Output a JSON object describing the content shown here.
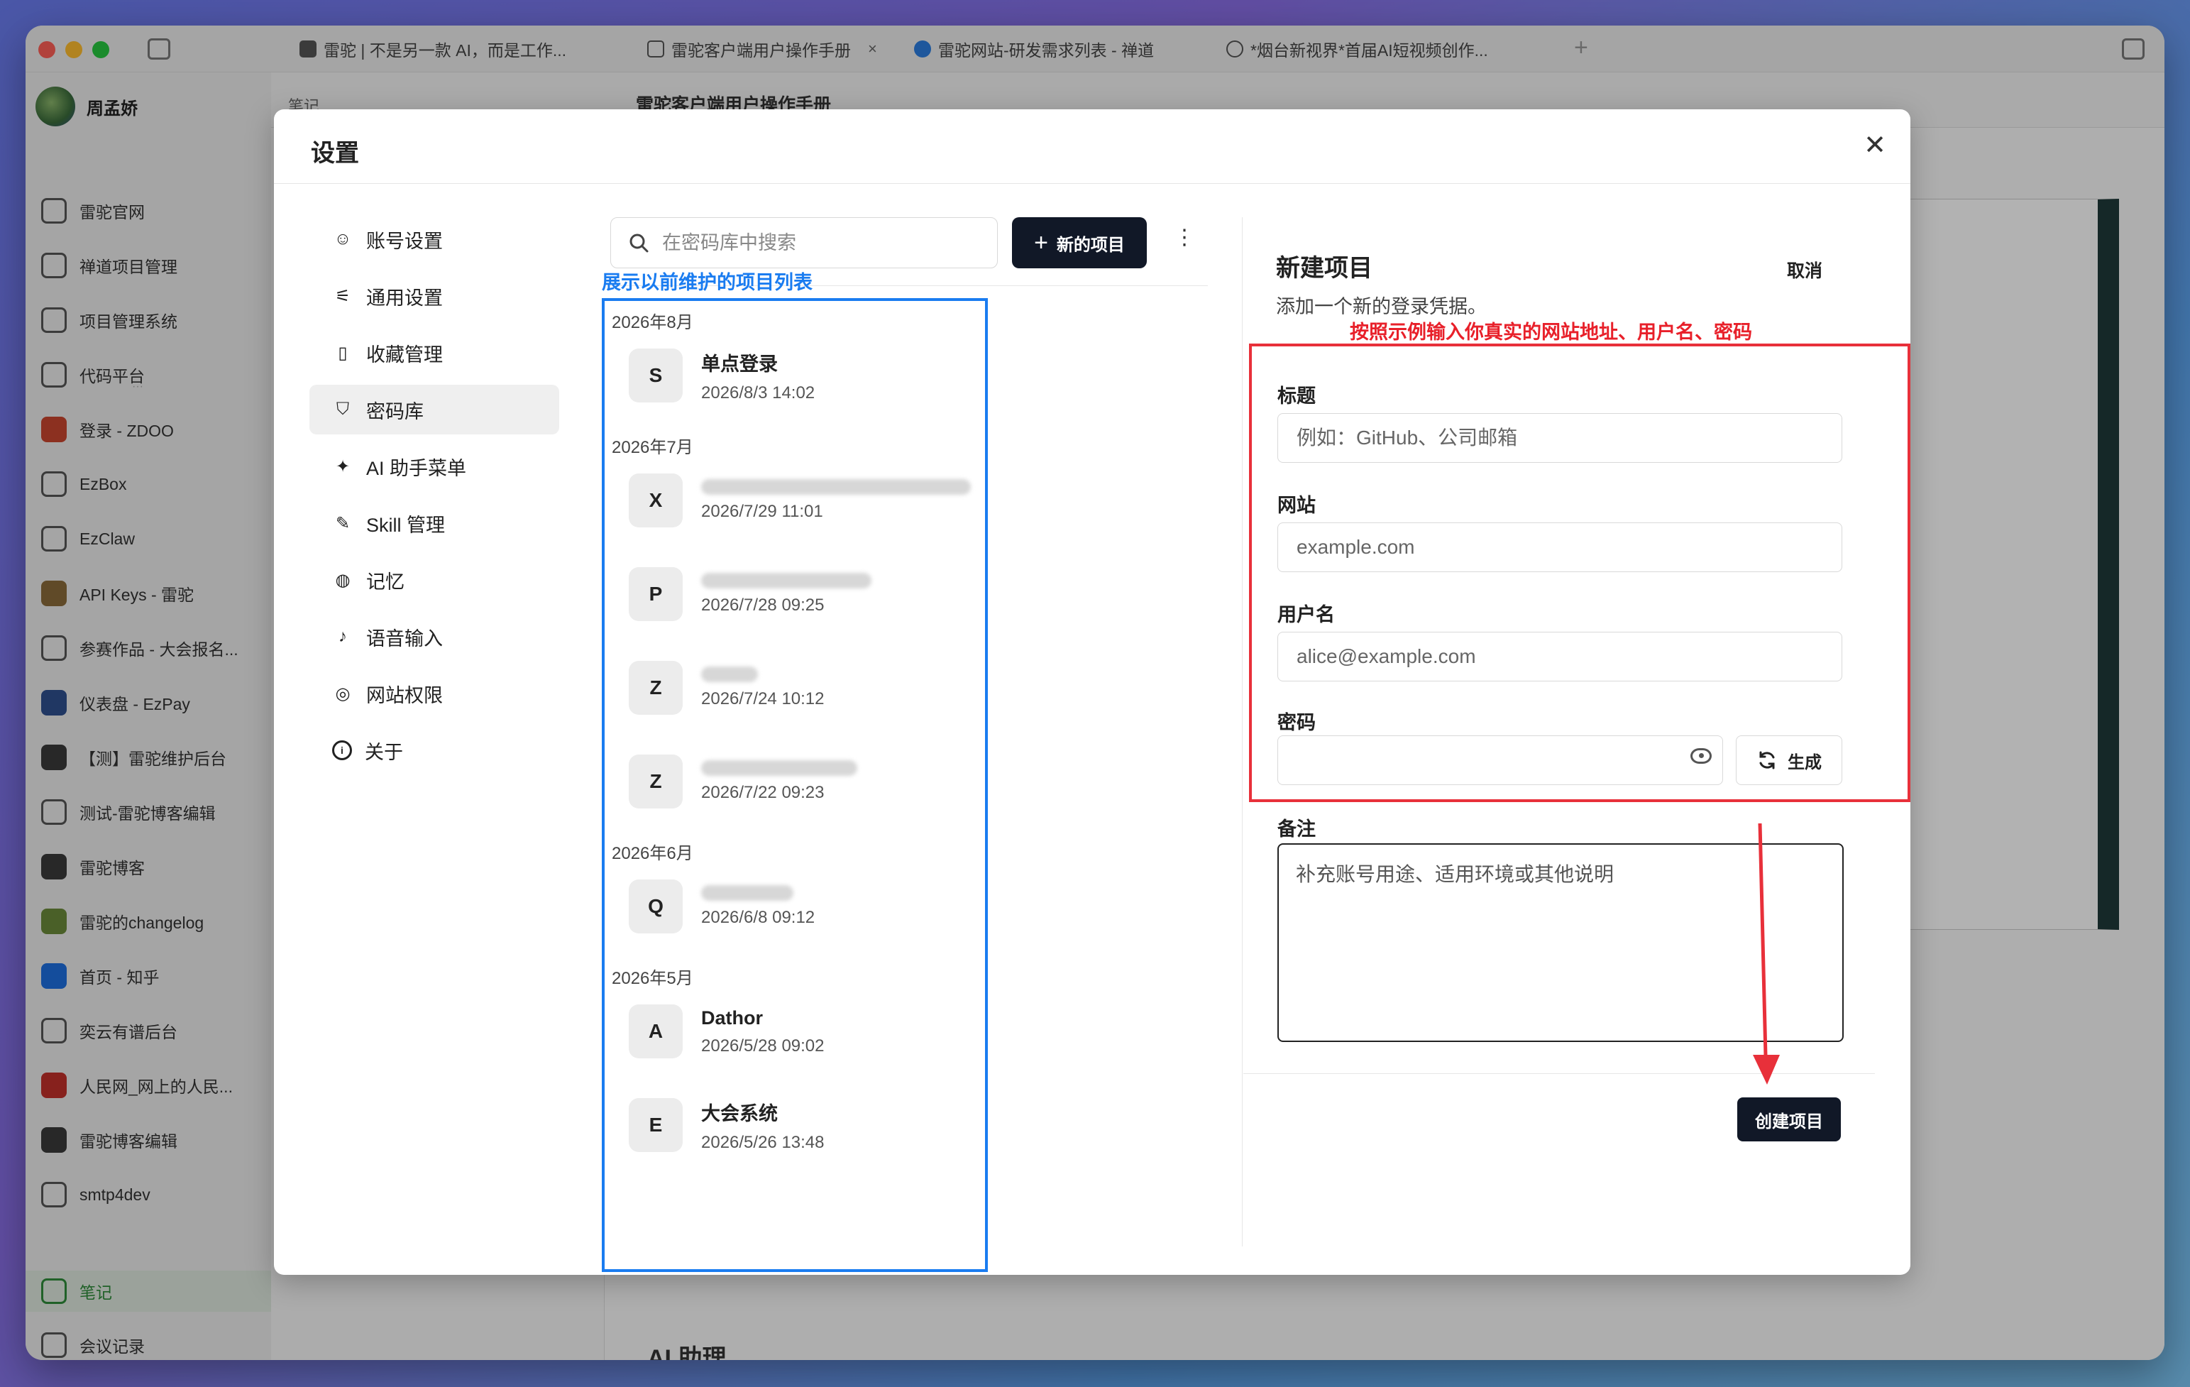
{
  "tabs": [
    {
      "label": "雷驼 | 不是另一款 AI，而是工作..."
    },
    {
      "label": "雷驼客户端用户操作手册"
    },
    {
      "label": "雷驼网站-研发需求列表 - 禅道"
    },
    {
      "label": "*烟台新视界*首届AI短视频创作..."
    }
  ],
  "app_sidebar": {
    "user": "周孟娇",
    "items": [
      {
        "label": "雷驼官网",
        "icon": "home-icon"
      },
      {
        "label": "禅道项目管理",
        "icon": "briefcase-icon"
      },
      {
        "label": "项目管理系统",
        "icon": "grid-icon"
      },
      {
        "label": "代码平台",
        "icon": "code-icon"
      },
      {
        "label": "登录 - ZDOO",
        "icon": "zdoo-icon"
      },
      {
        "label": "EzBox",
        "icon": "folder-icon"
      },
      {
        "label": "EzClaw",
        "icon": "mail-icon"
      },
      {
        "label": "API Keys - 雷驼",
        "icon": "camel-icon"
      },
      {
        "label": "参赛作品 - 大会报名...",
        "icon": "globe-icon"
      },
      {
        "label": "仪表盘 - EzPay",
        "icon": "ezpay-icon"
      },
      {
        "label": "【测】雷驼维护后台",
        "icon": "admin-icon"
      },
      {
        "label": "测试-雷驼博客编辑",
        "icon": "globe-icon"
      },
      {
        "label": "雷驼博客",
        "icon": "blog-icon"
      },
      {
        "label": "雷驼的changelog",
        "icon": "camel-icon"
      },
      {
        "label": "首页 - 知乎",
        "icon": "zhihu-icon"
      },
      {
        "label": "奕云有谱后台",
        "icon": "globe-icon"
      },
      {
        "label": "人民网_网上的人民...",
        "icon": "people-icon"
      },
      {
        "label": "雷驼博客编辑",
        "icon": "blog-icon"
      },
      {
        "label": "smtp4dev",
        "icon": "globe-icon"
      }
    ],
    "bottom": [
      {
        "label": "笔记",
        "icon": "note-icon"
      },
      {
        "label": "会议记录",
        "icon": "calendar-icon"
      }
    ]
  },
  "behind": {
    "notes_label": "笔记",
    "doc_title": "雷驼客户端用户操作手册",
    "ai_title": "AI 助理"
  },
  "dialog": {
    "title": "设置",
    "nav": [
      {
        "label": "账号设置",
        "icon": "user-circle-icon"
      },
      {
        "label": "通用设置",
        "icon": "sliders-icon"
      },
      {
        "label": "收藏管理",
        "icon": "bookmark-icon"
      },
      {
        "label": "密码库",
        "icon": "shield-icon"
      },
      {
        "label": "AI 助手菜单",
        "icon": "sparkles-icon"
      },
      {
        "label": "Skill 管理",
        "icon": "wand-icon"
      },
      {
        "label": "记忆",
        "icon": "brain-icon"
      },
      {
        "label": "语音输入",
        "icon": "mic-icon"
      },
      {
        "label": "网站权限",
        "icon": "globe-icon"
      },
      {
        "label": "关于",
        "icon": "info-icon"
      }
    ],
    "vault": {
      "search_placeholder": "在密码库中搜索",
      "new_button": "新的项目",
      "groups": [
        {
          "label": "2026年8月",
          "entries": [
            {
              "letter": "S",
              "title": "单点登录",
              "date": "2026/8/3 14:02"
            }
          ]
        },
        {
          "label": "2026年7月",
          "entries": [
            {
              "letter": "X",
              "title": "",
              "date": "2026/7/29 11:01"
            },
            {
              "letter": "P",
              "title": "",
              "date": "2026/7/28 09:25"
            },
            {
              "letter": "Z",
              "title": "",
              "date": "2026/7/24 10:12"
            },
            {
              "letter": "Z",
              "title": "",
              "date": "2026/7/22 09:23"
            }
          ]
        },
        {
          "label": "2026年6月",
          "entries": [
            {
              "letter": "Q",
              "title": "",
              "date": "2026/6/8 09:12"
            }
          ]
        },
        {
          "label": "2026年5月",
          "entries": [
            {
              "letter": "A",
              "title": "Dathor",
              "date": "2026/5/28 09:02"
            },
            {
              "letter": "E",
              "title": "大会系统",
              "date": "2026/5/26 13:48"
            }
          ]
        }
      ]
    },
    "form": {
      "title": "新建项目",
      "cancel": "取消",
      "description": "添加一个新的登录凭据。",
      "title_label": "标题",
      "title_placeholder": "例如：GitHub、公司邮箱",
      "site_label": "网站",
      "site_placeholder": "example.com",
      "username_label": "用户名",
      "username_placeholder": "alice@example.com",
      "password_label": "密码",
      "generate_button": "生成",
      "notes_label": "备注",
      "notes_placeholder": "补充账号用途、适用环境或其他说明",
      "create_button": "创建项目"
    }
  },
  "annotations": {
    "blue_note": "展示以前维护的项目列表",
    "red_note": "按照示例输入你真实的网站地址、用户名、密码",
    "blue_color": "#1a7cf0",
    "red_color": "#e8202a"
  }
}
